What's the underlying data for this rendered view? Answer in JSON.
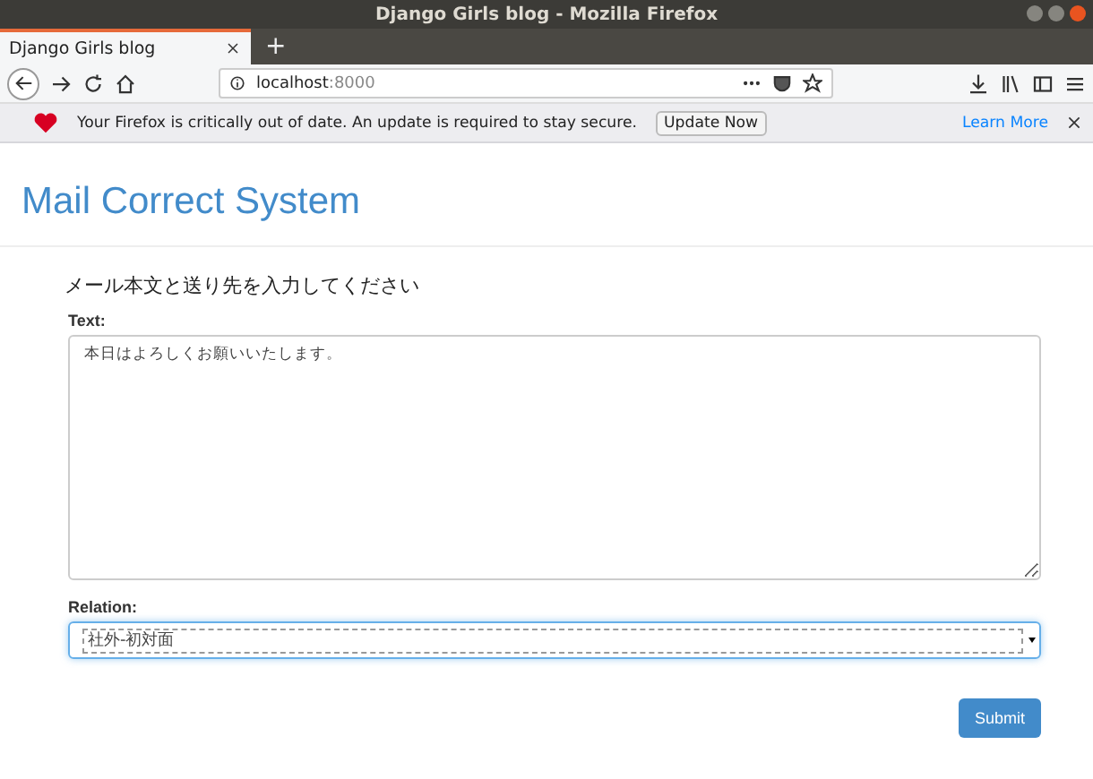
{
  "window": {
    "title": "Django Girls blog - Mozilla Firefox"
  },
  "tabs": [
    {
      "label": "Django Girls blog",
      "selected": true
    }
  ],
  "new_tab": "+",
  "address_bar": {
    "host": "localhost",
    "port": ":8000"
  },
  "notification": {
    "message": "Your Firefox is critically out of date. An update is required to stay secure.",
    "button": "Update Now",
    "link": "Learn More"
  },
  "page": {
    "site_title": "Mail Correct System",
    "heading": "メール本文と送り先を入力してください",
    "fields": [
      {
        "kind": "textarea",
        "label": "Text:",
        "value": "本日はよろしくお願いいたします。"
      },
      {
        "kind": "select",
        "label": "Relation:",
        "value": "社外-初対面"
      }
    ],
    "submit": "Submit"
  }
}
